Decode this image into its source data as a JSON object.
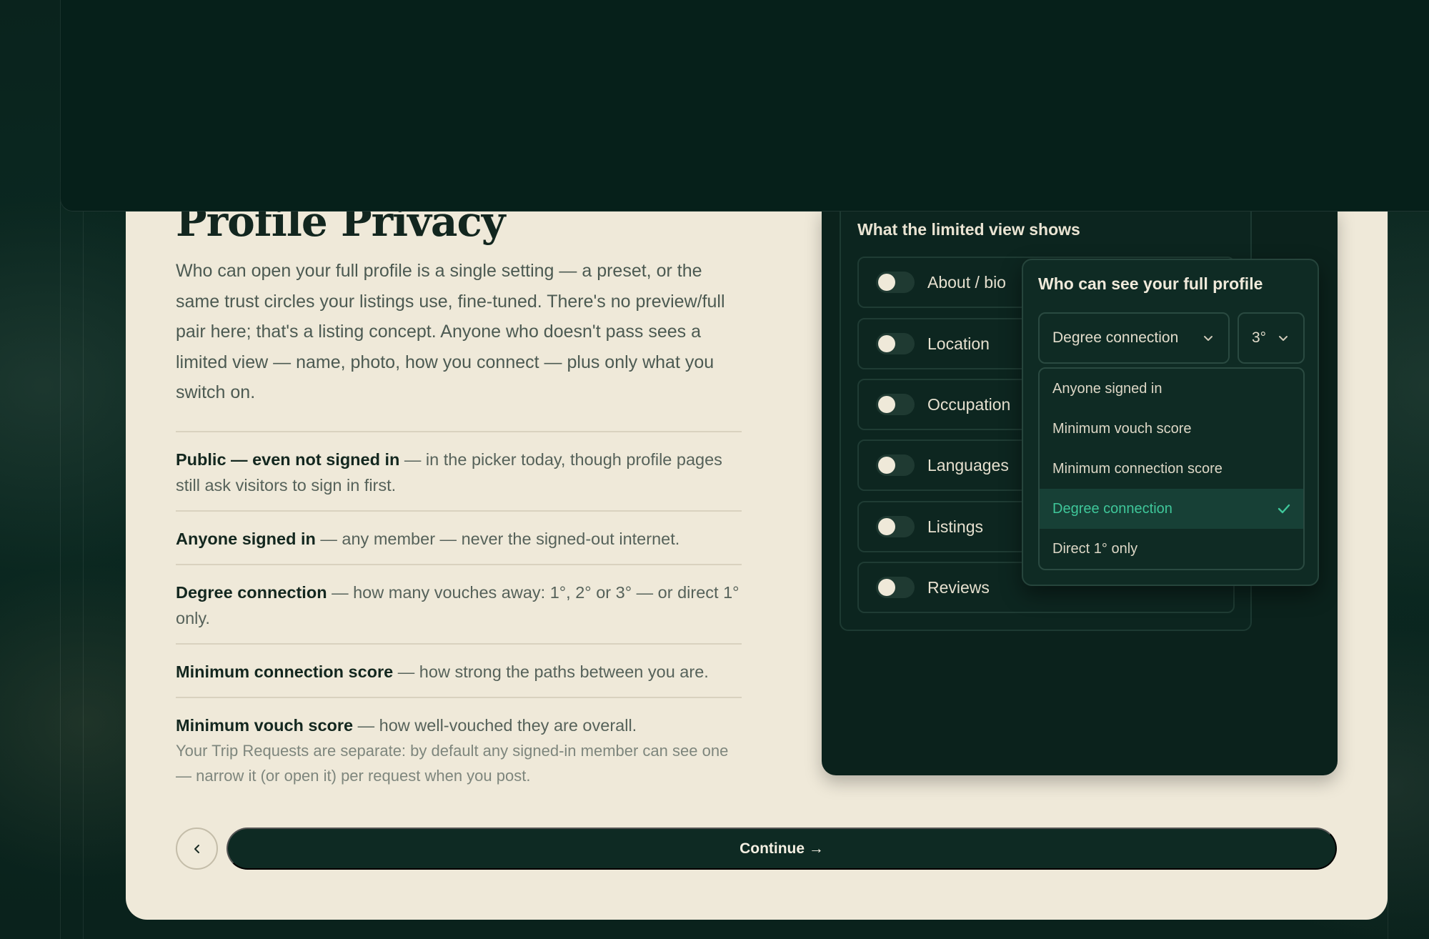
{
  "page": {
    "title": "Profile Privacy",
    "intro": "Who can open your full profile is a single setting — a preset, or the same trust circles your listings use, fine-tuned. There's no preview/full pair here; that's a listing concept. Anyone who doesn't pass sees a limited view — name, photo, how you connect — plus only what you switch on.",
    "definitions": [
      {
        "term": "Public — even not signed in",
        "desc": " — in the picker today, though profile pages still ask visitors to sign in first."
      },
      {
        "term": "Anyone signed in",
        "desc": " — any member — never the signed-out internet."
      },
      {
        "term": "Degree connection",
        "desc": " — how many vouches away: 1°, 2° or 3° — or direct 1° only."
      },
      {
        "term": "Minimum connection score",
        "desc": " — how strong the paths between you are."
      },
      {
        "term": "Minimum vouch score",
        "desc": " — how well-vouched they are overall."
      }
    ],
    "note": "Your Trip Requests are separate: by default any signed-in member can see one — narrow it (or open it) per request when you post.",
    "continue_label": "Continue →",
    "back_icon": "chevron-left-icon"
  },
  "limited_view": {
    "heading": "What the limited view shows",
    "toggles": [
      {
        "label": "About / bio",
        "on": false
      },
      {
        "label": "Location",
        "on": false
      },
      {
        "label": "Occupation",
        "on": false
      },
      {
        "label": "Languages",
        "on": false
      },
      {
        "label": "Listings",
        "on": false
      },
      {
        "label": "Reviews",
        "on": false
      }
    ]
  },
  "popover": {
    "title": "Who can see your full profile",
    "selected_value": "Degree connection",
    "degree_value": "3°",
    "options": [
      {
        "label": "Anyone signed in",
        "selected": false
      },
      {
        "label": "Minimum vouch score",
        "selected": false
      },
      {
        "label": "Minimum connection score",
        "selected": false
      },
      {
        "label": "Degree connection",
        "selected": true
      },
      {
        "label": "Direct 1° only",
        "selected": false
      }
    ]
  },
  "colors": {
    "accent_green": "#3fc79a",
    "dark_bg": "#07211b",
    "card_bg": "#efe9d9"
  }
}
